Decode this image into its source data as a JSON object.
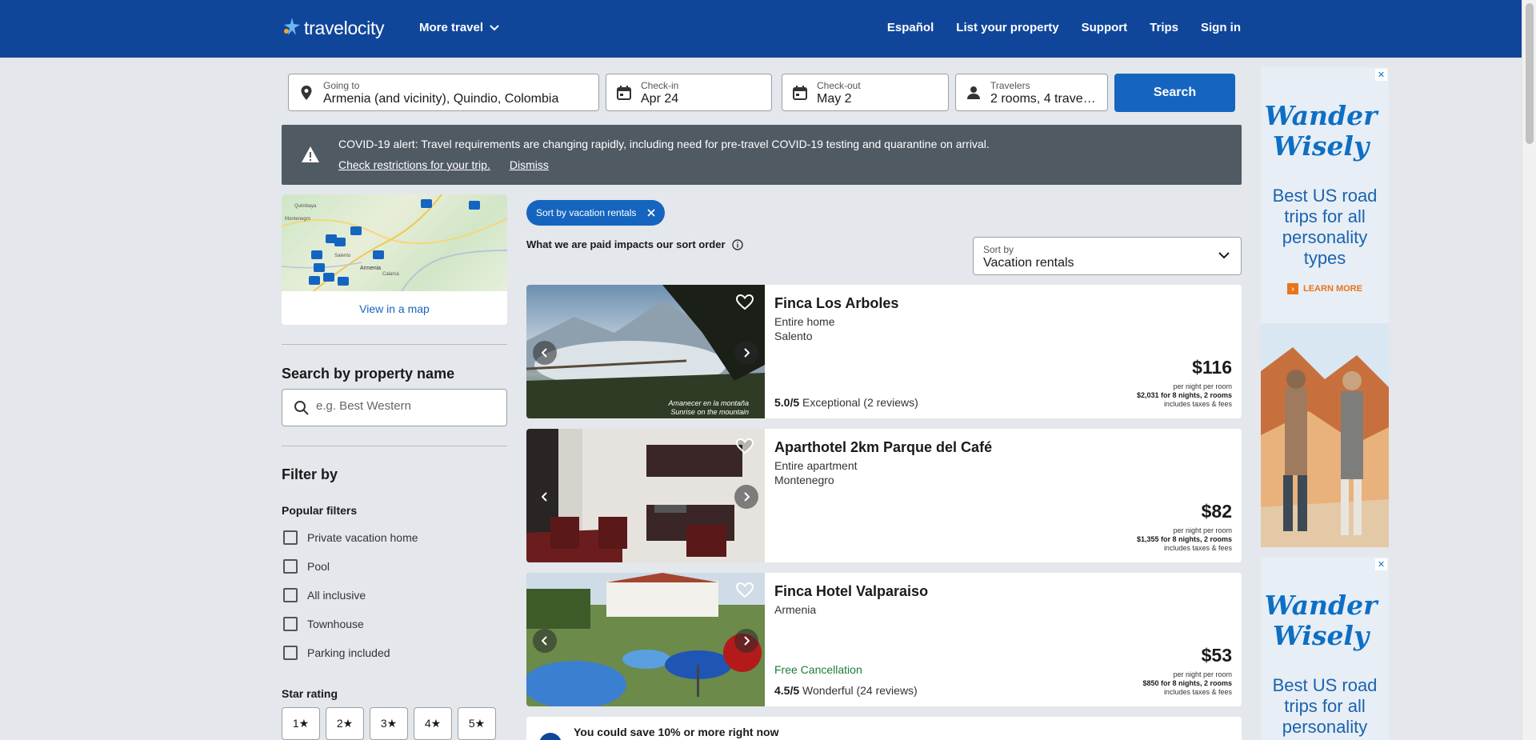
{
  "header": {
    "logo_text": "travelocity",
    "more_travel": "More travel",
    "nav": [
      "Español",
      "List your property",
      "Support",
      "Trips",
      "Sign in"
    ]
  },
  "search": {
    "going_to_label": "Going to",
    "going_to_value": "Armenia (and vicinity), Quindio, Colombia",
    "checkin_label": "Check-in",
    "checkin_value": "Apr 24",
    "checkout_label": "Check-out",
    "checkout_value": "May 2",
    "travelers_label": "Travelers",
    "travelers_value": "2 rooms, 4 travelers",
    "button": "Search"
  },
  "alert": {
    "message": "COVID-19 alert: Travel requirements are changing rapidly, including need for pre-travel COVID-19 testing and quarantine on arrival.",
    "link": "Check restrictions for your trip.",
    "dismiss": "Dismiss"
  },
  "map": {
    "link": "View in a map",
    "labels": [
      "Salento",
      "Armenia",
      "Calarcá",
      "Montenegro",
      "Quimbaya"
    ]
  },
  "sidebar": {
    "search_title": "Search by property name",
    "search_placeholder": "e.g. Best Western",
    "filter_title": "Filter by",
    "popular_title": "Popular filters",
    "popular": [
      "Private vacation home",
      "Pool",
      "All inclusive",
      "Townhouse",
      "Parking included"
    ],
    "star_title": "Star rating",
    "stars": [
      "1★",
      "2★",
      "3★",
      "4★",
      "5★"
    ]
  },
  "results": {
    "chip": "Sort by vacation rentals",
    "paid_note": "What we are paid impacts our sort order",
    "sort_label": "Sort by",
    "sort_value": "Vacation rentals",
    "cards": [
      {
        "name": "Finca Los Arboles",
        "type": "Entire home",
        "location": "Salento",
        "cancel": "",
        "rating": "5.0/5",
        "rating_text": "Exceptional (2 reviews)",
        "price": "$116",
        "per_night": "per night per room",
        "total": "$2,031 for 8 nights, 2 rooms",
        "taxes": "includes taxes & fees",
        "photo_caption": "Amanecer en la montaña\nSunrise on the mountain"
      },
      {
        "name": "Aparthotel 2km Parque del Café",
        "type": "Entire apartment",
        "location": "Montenegro",
        "cancel": "",
        "rating": "",
        "rating_text": "",
        "price": "$82",
        "per_night": "per night per room",
        "total": "$1,355 for 8 nights, 2 rooms",
        "taxes": "includes taxes & fees"
      },
      {
        "name": "Finca Hotel Valparaiso",
        "type": "Armenia",
        "location": "",
        "cancel": "Free Cancellation",
        "rating": "4.5/5",
        "rating_text": "Wonderful (24 reviews)",
        "price": "$53",
        "per_night": "per night per room",
        "total": "$850 for 8 nights, 2 rooms",
        "taxes": "includes taxes & fees"
      }
    ],
    "save_banner": "You could save 10% or more right now"
  },
  "ads": [
    {
      "brand": "Wander Wisely",
      "copy": "Best US road trips for all personality types",
      "cta": "LEARN MORE"
    },
    {
      "brand": "Wander Wisely",
      "copy": "Best US road trips for all personality"
    }
  ],
  "colors": {
    "header": "#10469a",
    "accent": "#1565c0",
    "alert": "#505a63",
    "ad_brand": "#0e6fc4",
    "cta": "#e8741a",
    "cancel": "#1b7c3a"
  }
}
